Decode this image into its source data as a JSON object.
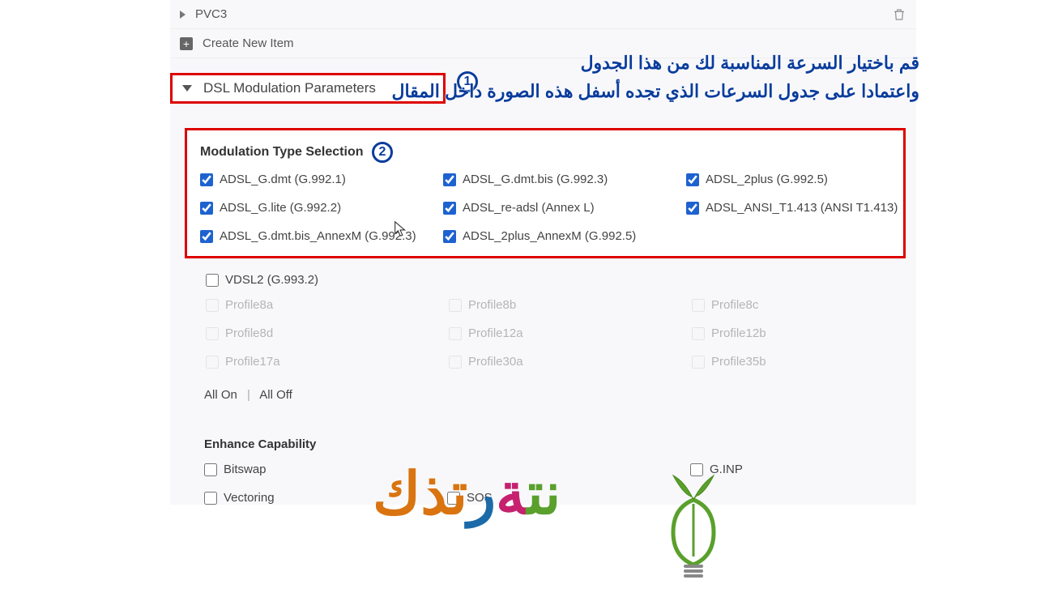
{
  "items": {
    "pvc3": "PVC3",
    "create": "Create New Item"
  },
  "section": {
    "title": "DSL Modulation Parameters"
  },
  "badges": {
    "one": "1",
    "two": "2"
  },
  "modType": {
    "heading": "Modulation Type Selection",
    "c0": "ADSL_G.dmt (G.992.1)",
    "c1": "ADSL_G.dmt.bis (G.992.3)",
    "c2": "ADSL_2plus (G.992.5)",
    "c3": "ADSL_G.lite (G.992.2)",
    "c4": "ADSL_re-adsl (Annex L)",
    "c5": "ADSL_ANSI_T1.413 (ANSI T1.413)",
    "c6": "ADSL_G.dmt.bis_AnnexM (G.992.3)",
    "c7": "ADSL_2plus_AnnexM (G.992.5)"
  },
  "vdsl": {
    "label": "VDSL2 (G.993.2)"
  },
  "profiles": {
    "p0": "Profile8a",
    "p1": "Profile8b",
    "p2": "Profile8c",
    "p3": "Profile8d",
    "p4": "Profile12a",
    "p5": "Profile12b",
    "p6": "Profile17a",
    "p7": "Profile30a",
    "p8": "Profile35b"
  },
  "allRow": {
    "on": "All On",
    "off": "All Off"
  },
  "enhance": {
    "heading": "Enhance Capability",
    "bitswap": "Bitswap",
    "ginp": "G.INP",
    "vectoring": "Vectoring",
    "sos": "SOS"
  },
  "arabic": {
    "l1": "قم باختيار السرعة المناسبة لك من هذا الجدول",
    "l2": "واعتمادا على جدول السرعات الذي تجده أسفل هذه الصورة داخل المقال"
  },
  "watermark": {
    "t1": "نت",
    "t2": "ة",
    "t3": "ر",
    "t4": "تذك"
  }
}
